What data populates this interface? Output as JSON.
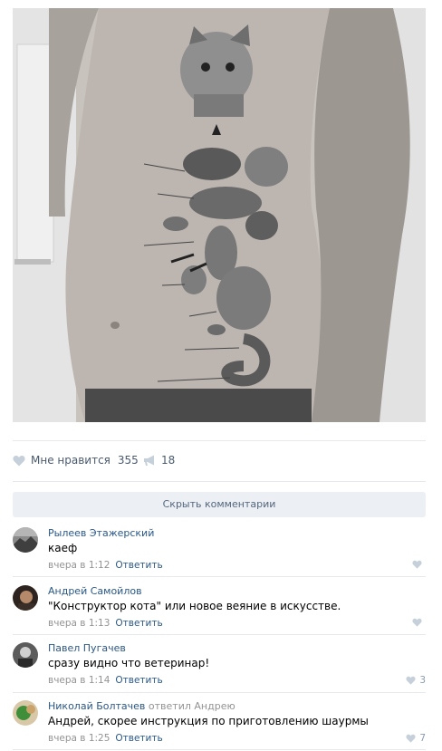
{
  "post": {
    "likes": {
      "label": "Мне нравится",
      "count": "355",
      "icon": "heart-icon"
    },
    "shares": {
      "count": "18",
      "icon": "megaphone-icon"
    }
  },
  "comments_toggle": {
    "label": "Скрыть комментарии"
  },
  "comments": [
    {
      "author": "Рылеев Этажерский",
      "replied_to": "",
      "text": "каеф",
      "time": "вчера в 1:12",
      "reply_label": "Ответить",
      "likes": ""
    },
    {
      "author": "Андрей Самойлов",
      "replied_to": "",
      "text": "\"Конструктор кота\" или новое веяние в искусстве.",
      "time": "вчера в 1:13",
      "reply_label": "Ответить",
      "likes": ""
    },
    {
      "author": "Павел Пугачев",
      "replied_to": "",
      "text": "сразу видно что ветеринар!",
      "time": "вчера в 1:14",
      "reply_label": "Ответить",
      "likes": "3"
    },
    {
      "author": "Николай Болтачев",
      "replied_to": "ответил Андрею",
      "text": "Андрей, скорее инструкция по приготовлению шаурмы",
      "time": "вчера в 1:25",
      "reply_label": "Ответить",
      "likes": "7"
    }
  ],
  "colors": {
    "link": "#2a5885",
    "muted": "#939393",
    "button_bg": "#eceff3"
  }
}
